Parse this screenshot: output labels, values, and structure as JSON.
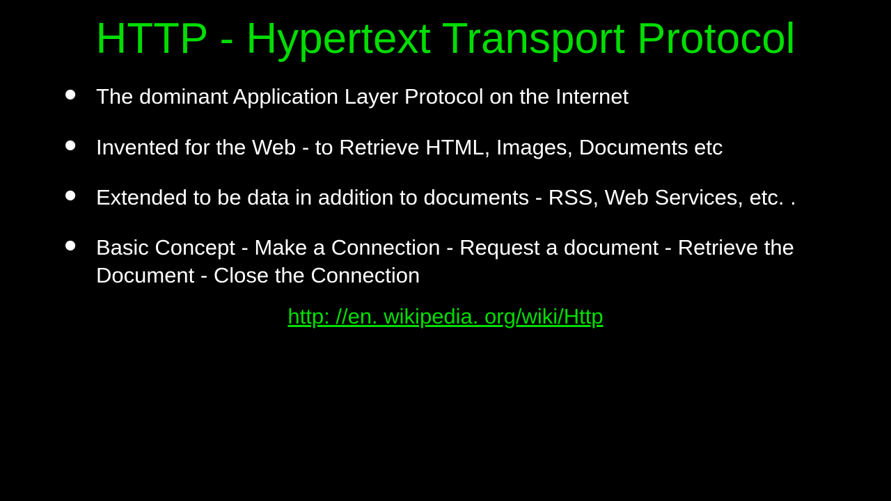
{
  "slide": {
    "title": "HTTP - Hypertext Transport Protocol",
    "bullets": [
      "The dominant Application Layer Protocol on the Internet",
      "Invented for the Web - to Retrieve HTML,  Images, Documents etc",
      "Extended to be data in addition to documents - RSS, Web Services, etc. .",
      "Basic Concept - Make a Connection - Request a document - Retrieve the Document - Close the Connection"
    ],
    "link_text": "http: //en. wikipedia. org/wiki/Http"
  }
}
